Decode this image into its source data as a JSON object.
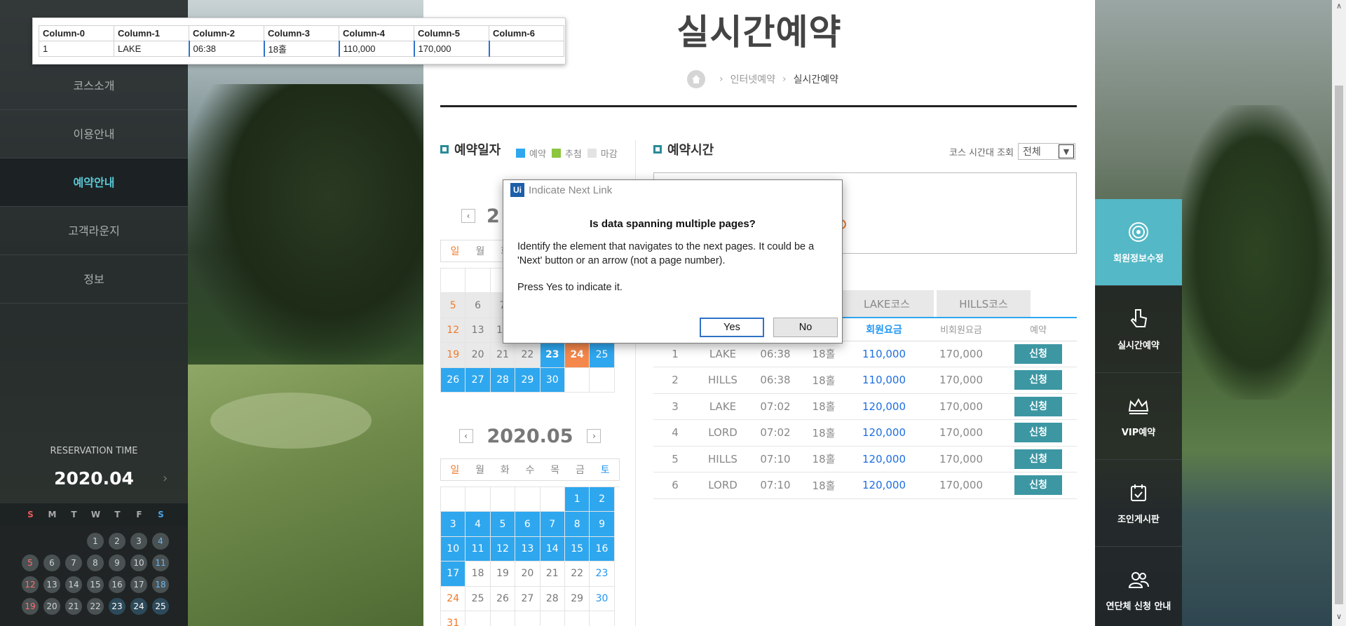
{
  "sidebar": {
    "items": [
      {
        "label": "코스소개"
      },
      {
        "label": "이용안내"
      },
      {
        "label": "예약안내"
      },
      {
        "label": "고객라운지"
      },
      {
        "label": "정보"
      }
    ],
    "reservation_label": "RESERVATION TIME",
    "reservation_month": "2020.04",
    "weekdays": [
      "S",
      "M",
      "T",
      "W",
      "T",
      "F",
      "S"
    ],
    "mini_days": [
      "",
      "",
      "",
      "1",
      "2",
      "3",
      "4",
      "5",
      "6",
      "7",
      "8",
      "9",
      "10",
      "11",
      "12",
      "13",
      "14",
      "15",
      "16",
      "17",
      "18",
      "19",
      "20",
      "21",
      "22",
      "23",
      "24",
      "25"
    ]
  },
  "main": {
    "title": "실시간예약",
    "breadcrumb": [
      "인터넷예약",
      "실시간예약"
    ],
    "date_section": "예약일자",
    "legend": [
      "예약",
      "추첨",
      "마감"
    ],
    "legend_colors": [
      "#2ea7ef",
      "#8cc63f",
      "#e3e3e3"
    ],
    "time_section": "예약시간",
    "course_filter_label": "코스 시간대 조회",
    "course_filter_value": "전체",
    "tabs": [
      "LAKE코스",
      "HILLS코스"
    ],
    "table_headers": [
      "",
      "",
      "",
      "",
      "회원요금",
      "비회원요금",
      "예약"
    ],
    "apply_label": "신청",
    "rows": [
      [
        "1",
        "LAKE",
        "06:38",
        "18홀",
        "110,000",
        "170,000"
      ],
      [
        "2",
        "HILLS",
        "06:38",
        "18홀",
        "110,000",
        "170,000"
      ],
      [
        "3",
        "LAKE",
        "07:02",
        "18홀",
        "120,000",
        "170,000"
      ],
      [
        "4",
        "LORD",
        "07:02",
        "18홀",
        "120,000",
        "170,000"
      ],
      [
        "5",
        "HILLS",
        "07:10",
        "18홀",
        "120,000",
        "170,000"
      ],
      [
        "6",
        "LORD",
        "07:10",
        "18홀",
        "120,000",
        "170,000"
      ]
    ]
  },
  "calendar_april": {
    "month_partial": "2",
    "dow": [
      "일",
      "월",
      "화"
    ],
    "row_a": [
      "5",
      "6",
      "7"
    ],
    "row_b": [
      "12",
      "13",
      "14"
    ],
    "row_c": [
      "19",
      "20",
      "21",
      "22",
      "23",
      "24",
      "25"
    ],
    "row_d": [
      "26",
      "27",
      "28",
      "29",
      "30",
      ""
    ]
  },
  "calendar_may": {
    "month": "2020.05",
    "dow": [
      "일",
      "월",
      "화",
      "수",
      "목",
      "금",
      "토"
    ],
    "days": [
      "",
      "",
      "",
      "",
      "",
      "1",
      "2",
      "3",
      "4",
      "5",
      "6",
      "7",
      "8",
      "9",
      "10",
      "11",
      "12",
      "13",
      "14",
      "15",
      "16",
      "17",
      "18",
      "19",
      "20",
      "21",
      "22",
      "23",
      "24",
      "25",
      "26",
      "27",
      "28",
      "29",
      "30",
      "31",
      "",
      "",
      "",
      "",
      "",
      ""
    ]
  },
  "quick_menu": [
    {
      "label": "회원정보수정",
      "icon": "target-icon"
    },
    {
      "label": "실시간예약",
      "icon": "hand-pointer-icon"
    },
    {
      "label": "VIP예약",
      "icon": "crown-icon"
    },
    {
      "label": "조인게시판",
      "icon": "calendar-icon"
    },
    {
      "label": "연단체 신청 안내",
      "icon": "group-icon"
    }
  ],
  "preview": {
    "headers": [
      "Column-0",
      "Column-1",
      "Column-2",
      "Column-3",
      "Column-4",
      "Column-5",
      "Column-6"
    ],
    "row": [
      "1",
      "LAKE",
      "06:38",
      "18홀",
      "110,000",
      "170,000",
      ""
    ]
  },
  "dialog": {
    "title": "Indicate Next Link",
    "question": "Is data spanning multiple pages?",
    "body1": "Identify the element that navigates to the next pages. It could be a 'Next' button or an arrow (not a page number).",
    "body2": "Press Yes to indicate it.",
    "yes": "Yes",
    "no": "No"
  }
}
